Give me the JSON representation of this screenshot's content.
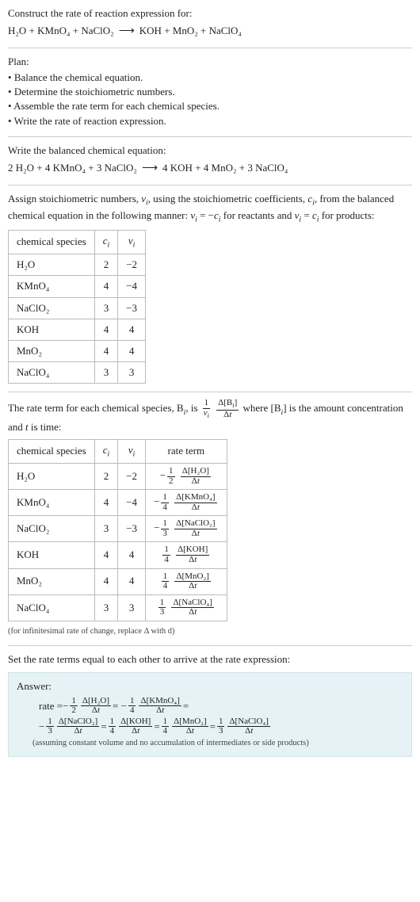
{
  "header": {
    "prompt": "Construct the rate of reaction expression for:"
  },
  "reaction_unbalanced": {
    "lhs": [
      "H₂O",
      "KMnO₄",
      "NaClO₂"
    ],
    "rhs": [
      "KOH",
      "MnO₂",
      "NaClO₄"
    ]
  },
  "plan": {
    "title": "Plan:",
    "items": [
      "Balance the chemical equation.",
      "Determine the stoichiometric numbers.",
      "Assemble the rate term for each chemical species.",
      "Write the rate of reaction expression."
    ]
  },
  "balanced": {
    "title": "Write the balanced chemical equation:",
    "lhs": [
      {
        "coef": "2",
        "species": "H₂O"
      },
      {
        "coef": "4",
        "species": "KMnO₄"
      },
      {
        "coef": "3",
        "species": "NaClO₂"
      }
    ],
    "rhs": [
      {
        "coef": "4",
        "species": "KOH"
      },
      {
        "coef": "4",
        "species": "MnO₂"
      },
      {
        "coef": "3",
        "species": "NaClO₄"
      }
    ]
  },
  "stoich_text": {
    "line1a": "Assign stoichiometric numbers, ",
    "line1b": ", using the stoichiometric coefficients, ",
    "line1c": ", from the balanced chemical equation in the following manner: ",
    "line1d": " for reactants and ",
    "line1e": " for products:",
    "nu_i": "ν",
    "c_i": "c",
    "eq1": "νᵢ = −cᵢ",
    "eq2": "νᵢ = cᵢ"
  },
  "stoich_table": {
    "headers": [
      "chemical species",
      "cᵢ",
      "νᵢ"
    ],
    "rows": [
      [
        "H₂O",
        "2",
        "−2"
      ],
      [
        "KMnO₄",
        "4",
        "−4"
      ],
      [
        "NaClO₂",
        "3",
        "−3"
      ],
      [
        "KOH",
        "4",
        "4"
      ],
      [
        "MnO₂",
        "4",
        "4"
      ],
      [
        "NaClO₄",
        "3",
        "3"
      ]
    ]
  },
  "rate_term_text": {
    "a": "The rate term for each chemical species, B",
    "b": ", is ",
    "c": " where [B",
    "d": "] is the amount concentration and ",
    "e": " is time:",
    "t": "t"
  },
  "rate_table": {
    "headers": [
      "chemical species",
      "cᵢ",
      "νᵢ",
      "rate term"
    ],
    "rows": [
      {
        "species": "H₂O",
        "c": "2",
        "nu": "−2",
        "sign": "−",
        "frac_num": "1",
        "frac_den": "2",
        "conc": "Δ[H₂O]"
      },
      {
        "species": "KMnO₄",
        "c": "4",
        "nu": "−4",
        "sign": "−",
        "frac_num": "1",
        "frac_den": "4",
        "conc": "Δ[KMnO₄]"
      },
      {
        "species": "NaClO₂",
        "c": "3",
        "nu": "−3",
        "sign": "−",
        "frac_num": "1",
        "frac_den": "3",
        "conc": "Δ[NaClO₂]"
      },
      {
        "species": "KOH",
        "c": "4",
        "nu": "4",
        "sign": "",
        "frac_num": "1",
        "frac_den": "4",
        "conc": "Δ[KOH]"
      },
      {
        "species": "MnO₂",
        "c": "4",
        "nu": "4",
        "sign": "",
        "frac_num": "1",
        "frac_den": "4",
        "conc": "Δ[MnO₂]"
      },
      {
        "species": "NaClO₄",
        "c": "3",
        "nu": "3",
        "sign": "",
        "frac_num": "1",
        "frac_den": "3",
        "conc": "Δ[NaClO₄]"
      }
    ],
    "dt": "Δt",
    "note": "(for infinitesimal rate of change, replace Δ with d)"
  },
  "final_text": "Set the rate terms equal to each other to arrive at the rate expression:",
  "answer": {
    "title": "Answer:",
    "rate_label": "rate = ",
    "eq": " = ",
    "terms": [
      {
        "sign": "−",
        "num": "1",
        "den": "2",
        "conc": "Δ[H₂O]"
      },
      {
        "sign": "−",
        "num": "1",
        "den": "4",
        "conc": "Δ[KMnO₄]"
      },
      {
        "sign": "−",
        "num": "1",
        "den": "3",
        "conc": "Δ[NaClO₂]"
      },
      {
        "sign": "",
        "num": "1",
        "den": "4",
        "conc": "Δ[KOH]"
      },
      {
        "sign": "",
        "num": "1",
        "den": "4",
        "conc": "Δ[MnO₂]"
      },
      {
        "sign": "",
        "num": "1",
        "den": "3",
        "conc": "Δ[NaClO₄]"
      }
    ],
    "dt": "Δt",
    "note": "(assuming constant volume and no accumulation of intermediates or side products)"
  },
  "chart_data": {
    "type": "table",
    "title": "Stoichiometric numbers and rate terms",
    "tables": [
      {
        "name": "stoichiometric_numbers",
        "columns": [
          "chemical species",
          "c_i",
          "nu_i"
        ],
        "rows": [
          [
            "H2O",
            2,
            -2
          ],
          [
            "KMnO4",
            4,
            -4
          ],
          [
            "NaClO2",
            3,
            -3
          ],
          [
            "KOH",
            4,
            4
          ],
          [
            "MnO2",
            4,
            4
          ],
          [
            "NaClO4",
            3,
            3
          ]
        ]
      },
      {
        "name": "rate_terms",
        "columns": [
          "chemical species",
          "c_i",
          "nu_i",
          "rate_term"
        ],
        "rows": [
          [
            "H2O",
            2,
            -2,
            "-(1/2) d[H2O]/dt"
          ],
          [
            "KMnO4",
            4,
            -4,
            "-(1/4) d[KMnO4]/dt"
          ],
          [
            "NaClO2",
            3,
            -3,
            "-(1/3) d[NaClO2]/dt"
          ],
          [
            "KOH",
            4,
            4,
            "(1/4) d[KOH]/dt"
          ],
          [
            "MnO2",
            4,
            4,
            "(1/4) d[MnO2]/dt"
          ],
          [
            "NaClO4",
            3,
            3,
            "(1/3) d[NaClO4]/dt"
          ]
        ]
      }
    ],
    "balanced_equation": "2 H2O + 4 KMnO4 + 3 NaClO2 -> 4 KOH + 4 MnO2 + 3 NaClO4",
    "rate_expression": "rate = -(1/2) d[H2O]/dt = -(1/4) d[KMnO4]/dt = -(1/3) d[NaClO2]/dt = (1/4) d[KOH]/dt = (1/4) d[MnO2]/dt = (1/3) d[NaClO4]/dt"
  }
}
